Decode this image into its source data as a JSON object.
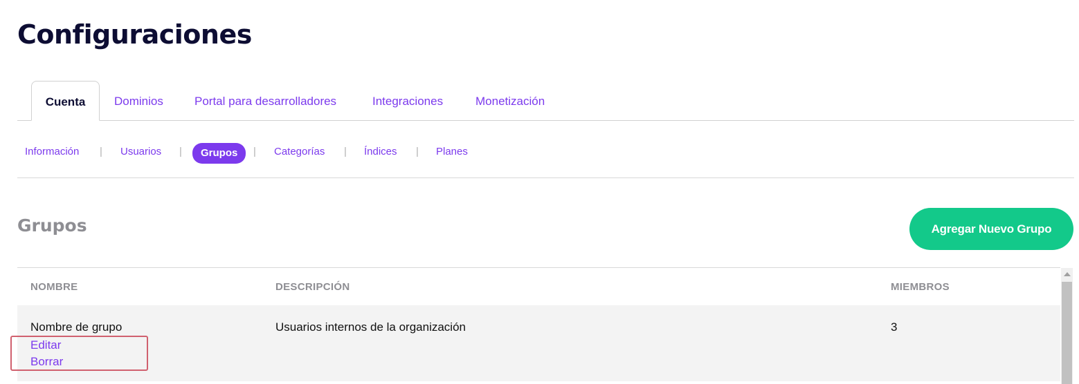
{
  "page": {
    "title": "Configuraciones"
  },
  "main_tabs": [
    {
      "label": "Cuenta",
      "active": true
    },
    {
      "label": "Dominios"
    },
    {
      "label": "Portal para desarrolladores"
    },
    {
      "label": "Integraciones"
    },
    {
      "label": "Monetización"
    }
  ],
  "sub_tabs": [
    {
      "label": "Información"
    },
    {
      "label": "Usuarios"
    },
    {
      "label": "Grupos",
      "active": true
    },
    {
      "label": "Categorías"
    },
    {
      "label": "Índices"
    },
    {
      "label": "Planes"
    }
  ],
  "separator": "|",
  "section": {
    "title": "Grupos",
    "add_button": "Agregar Nuevo Grupo"
  },
  "table": {
    "headers": [
      "NOMBRE",
      "DESCRIPCIÓN",
      "MIEMBROS"
    ],
    "rows": [
      {
        "name": "Nombre de grupo",
        "description": "Usuarios internos de la organización",
        "members": "3",
        "actions": [
          "Editar",
          "Borrar"
        ]
      }
    ]
  },
  "colors": {
    "accent": "#7c3aed",
    "button": "#13c98a",
    "highlight": "#d0606e",
    "muted": "#8e8e93"
  }
}
